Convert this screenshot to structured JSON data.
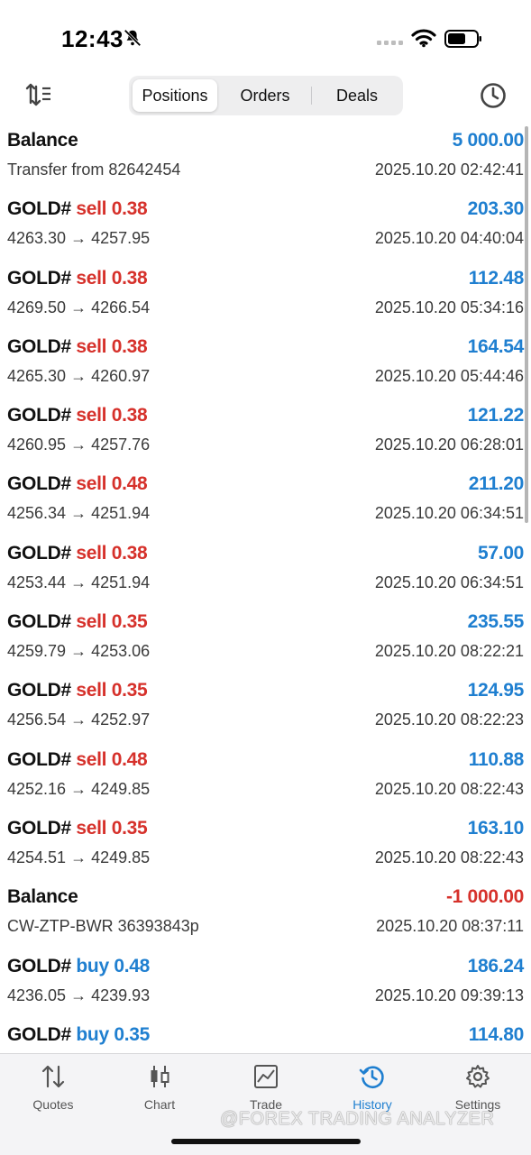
{
  "status_bar": {
    "time": "12:43"
  },
  "toolbar": {
    "segments": [
      {
        "label": "Positions",
        "active": true
      },
      {
        "label": "Orders",
        "active": false
      },
      {
        "label": "Deals",
        "active": false
      }
    ]
  },
  "rows": [
    {
      "type": "balance",
      "title": "Balance",
      "amount": "5 000.00",
      "sub": "Transfer from 82642454",
      "time": "2025.10.20 02:42:41"
    },
    {
      "type": "deal",
      "symbol": "GOLD#",
      "side": "sell",
      "volume": "0.38",
      "open": "4263.30",
      "close": "4257.95",
      "amount": "203.30",
      "time": "2025.10.20 04:40:04"
    },
    {
      "type": "deal",
      "symbol": "GOLD#",
      "side": "sell",
      "volume": "0.38",
      "open": "4269.50",
      "close": "4266.54",
      "amount": "112.48",
      "time": "2025.10.20 05:34:16"
    },
    {
      "type": "deal",
      "symbol": "GOLD#",
      "side": "sell",
      "volume": "0.38",
      "open": "4265.30",
      "close": "4260.97",
      "amount": "164.54",
      "time": "2025.10.20 05:44:46"
    },
    {
      "type": "deal",
      "symbol": "GOLD#",
      "side": "sell",
      "volume": "0.38",
      "open": "4260.95",
      "close": "4257.76",
      "amount": "121.22",
      "time": "2025.10.20 06:28:01"
    },
    {
      "type": "deal",
      "symbol": "GOLD#",
      "side": "sell",
      "volume": "0.48",
      "open": "4256.34",
      "close": "4251.94",
      "amount": "211.20",
      "time": "2025.10.20 06:34:51"
    },
    {
      "type": "deal",
      "symbol": "GOLD#",
      "side": "sell",
      "volume": "0.38",
      "open": "4253.44",
      "close": "4251.94",
      "amount": "57.00",
      "time": "2025.10.20 06:34:51"
    },
    {
      "type": "deal",
      "symbol": "GOLD#",
      "side": "sell",
      "volume": "0.35",
      "open": "4259.79",
      "close": "4253.06",
      "amount": "235.55",
      "time": "2025.10.20 08:22:21"
    },
    {
      "type": "deal",
      "symbol": "GOLD#",
      "side": "sell",
      "volume": "0.35",
      "open": "4256.54",
      "close": "4252.97",
      "amount": "124.95",
      "time": "2025.10.20 08:22:23"
    },
    {
      "type": "deal",
      "symbol": "GOLD#",
      "side": "sell",
      "volume": "0.48",
      "open": "4252.16",
      "close": "4249.85",
      "amount": "110.88",
      "time": "2025.10.20 08:22:43"
    },
    {
      "type": "deal",
      "symbol": "GOLD#",
      "side": "sell",
      "volume": "0.35",
      "open": "4254.51",
      "close": "4249.85",
      "amount": "163.10",
      "time": "2025.10.20 08:22:43"
    },
    {
      "type": "balance",
      "title": "Balance",
      "amount": "-1 000.00",
      "negative": true,
      "sub": "CW-ZTP-BWR 36393843p",
      "time": "2025.10.20 08:37:11"
    },
    {
      "type": "deal",
      "symbol": "GOLD#",
      "side": "buy",
      "volume": "0.48",
      "open": "4236.05",
      "close": "4239.93",
      "amount": "186.24",
      "time": "2025.10.20 09:39:13"
    },
    {
      "type": "deal",
      "symbol": "GOLD#",
      "side": "buy",
      "volume": "0.35",
      "open": "",
      "close": "",
      "amount": "114.80",
      "time": ""
    }
  ],
  "tabbar": {
    "tabs": [
      {
        "label": "Quotes",
        "icon": "arrows-updown-icon",
        "active": false
      },
      {
        "label": "Chart",
        "icon": "candlestick-icon",
        "active": false
      },
      {
        "label": "Trade",
        "icon": "trade-chart-icon",
        "active": false
      },
      {
        "label": "History",
        "icon": "history-icon",
        "active": true
      },
      {
        "label": "Settings",
        "icon": "gear-icon",
        "active": false
      }
    ]
  },
  "watermark": "@FOREX TRADING ANALYZER",
  "colors": {
    "accent": "#1f7fd0",
    "negative": "#d6312b"
  }
}
